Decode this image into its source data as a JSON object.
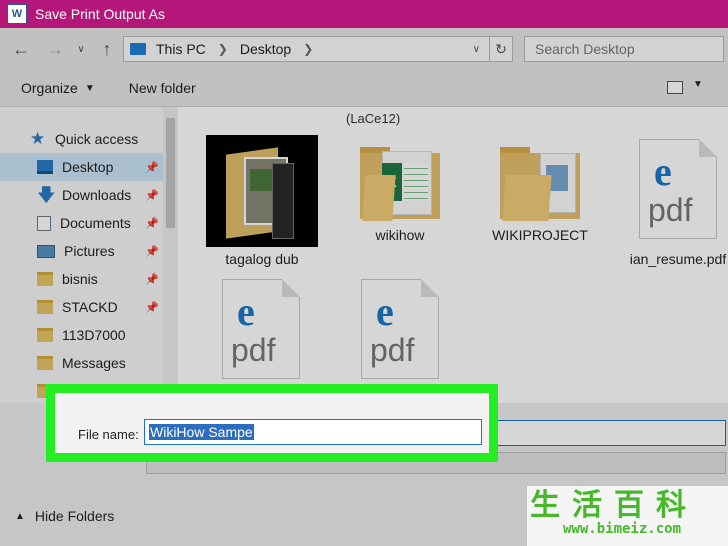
{
  "window": {
    "title": "Save Print Output As",
    "app_icon_letter": "W"
  },
  "nav": {
    "path": [
      "This PC",
      "Desktop"
    ],
    "search_placeholder": "Search Desktop"
  },
  "toolbar": {
    "organize_label": "Organize",
    "new_folder_label": "New folder"
  },
  "sidebar": {
    "items": [
      {
        "label": "Quick access",
        "icon": "star-icon"
      },
      {
        "label": "Desktop",
        "icon": "desktop-icon",
        "selected": true,
        "pinned": true
      },
      {
        "label": "Downloads",
        "icon": "download-icon",
        "pinned": true
      },
      {
        "label": "Documents",
        "icon": "documents-icon",
        "pinned": true
      },
      {
        "label": "Pictures",
        "icon": "pictures-icon",
        "pinned": true
      },
      {
        "label": "bisnis",
        "icon": "folder-icon",
        "pinned": true
      },
      {
        "label": "STACKD",
        "icon": "folder-icon",
        "pinned": true
      },
      {
        "label": "113D7000",
        "icon": "folder-icon"
      },
      {
        "label": "Messages",
        "icon": "folder-icon"
      }
    ]
  },
  "content": {
    "group_header": "(LaCe12)",
    "files": [
      {
        "name": "tagalog dub",
        "type": "image-folder"
      },
      {
        "name": "wikihow",
        "type": "excel-folder"
      },
      {
        "name": "WIKIPROJECT",
        "type": "folder"
      },
      {
        "name": "ian_resume.pdf",
        "type": "pdf"
      },
      {
        "name": "",
        "type": "pdf"
      },
      {
        "name": "",
        "type": "pdf"
      }
    ],
    "pdf_icon_letter": "e",
    "pdf_icon_text": "pdf"
  },
  "save": {
    "file_name_label": "File name:",
    "file_name_value": "WikiHow Sampe",
    "hide_folders_label": "Hide Folders",
    "highlight_color": "#22ee22"
  },
  "watermark": {
    "chinese": "生活百科",
    "url": "www.bimeiz.com"
  },
  "colors": {
    "titlebar": "#b5167a",
    "selection": "#cce4f7",
    "accent": "#1b77c9"
  }
}
